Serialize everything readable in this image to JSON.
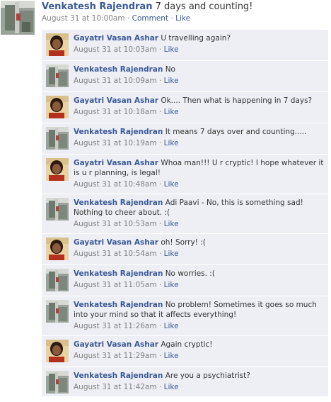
{
  "post": {
    "author": "Venkatesh Rajendran",
    "text": "7 days and counting!",
    "timestamp": "August 31 at 10:00am",
    "comment_label": "Comment",
    "like_label": "Like",
    "separator": "·"
  },
  "comments": [
    {
      "author": "Gayatri Vasan Ashar",
      "text": "U travelling again?",
      "timestamp": "August 31 at 10:03am",
      "like_label": "Like",
      "avatar": "woman"
    },
    {
      "author": "Venkatesh Rajendran",
      "text": "No",
      "timestamp": "August 31 at 10:09am",
      "like_label": "Like",
      "avatar": "man"
    },
    {
      "author": "Gayatri Vasan Ashar",
      "text": "Ok.... Then what is happening in 7 days?",
      "timestamp": "August 31 at 10:18am",
      "like_label": "Like",
      "avatar": "woman"
    },
    {
      "author": "Venkatesh Rajendran",
      "text": "It means 7 days over and counting.....",
      "timestamp": "August 31 at 10:19am",
      "like_label": "Like",
      "avatar": "man"
    },
    {
      "author": "Gayatri Vasan Ashar",
      "text": "Whoa man!!! U r cryptic! I hope whatever it is u r planning, is legal!",
      "timestamp": "August 31 at 10:48am",
      "like_label": "Like",
      "avatar": "woman"
    },
    {
      "author": "Venkatesh Rajendran",
      "text": "Adi Paavi - No, this is something sad! Nothing to cheer about. :(",
      "timestamp": "August 31 at 10:53am",
      "like_label": "Like",
      "avatar": "man"
    },
    {
      "author": "Gayatri Vasan Ashar",
      "text": "oh! Sorry! :(",
      "timestamp": "August 31 at 10:54am",
      "like_label": "Like",
      "avatar": "woman"
    },
    {
      "author": "Venkatesh Rajendran",
      "text": "No worries. :(",
      "timestamp": "August 31 at 11:05am",
      "like_label": "Like",
      "avatar": "man"
    },
    {
      "author": "Venkatesh Rajendran",
      "text": "No problem! Sometimes it goes so much into your mind so that it affects everything!",
      "timestamp": "August 31 at 11:26am",
      "like_label": "Like",
      "avatar": "man"
    },
    {
      "author": "Gayatri Vasan Ashar",
      "text": "Again cryptic!",
      "timestamp": "August 31 at 11:29am",
      "like_label": "Like",
      "avatar": "woman"
    },
    {
      "author": "Venkatesh Rajendran",
      "text": "Are you a psychiatrist?",
      "timestamp": "August 31 at 11:42am",
      "like_label": "Like",
      "avatar": "man"
    }
  ]
}
